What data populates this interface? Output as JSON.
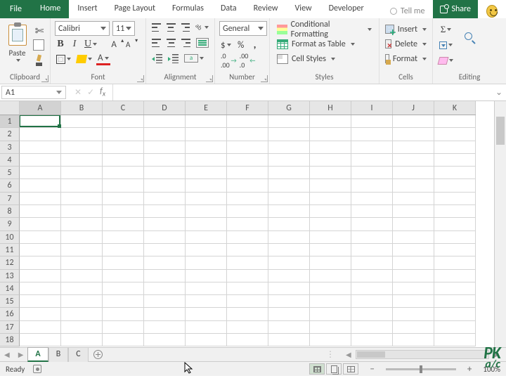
{
  "tabs": {
    "file": "File",
    "home": "Home",
    "insert": "Insert",
    "pagelayout": "Page Layout",
    "formulas": "Formulas",
    "data": "Data",
    "review": "Review",
    "view": "View",
    "developer": "Developer",
    "tellme": "Tell me",
    "share": "Share"
  },
  "ribbon": {
    "clipboard": {
      "label": "Clipboard",
      "paste": "Paste"
    },
    "font": {
      "label": "Font",
      "name": "Calibri",
      "size": "11"
    },
    "alignment": {
      "label": "Alignment"
    },
    "number": {
      "label": "Number",
      "format": "General"
    },
    "styles": {
      "label": "Styles",
      "cf": "Conditional Formatting",
      "table": "Format as Table",
      "cell": "Cell Styles"
    },
    "cells": {
      "label": "Cells",
      "insert": "Insert",
      "delete": "Delete",
      "format": "Format"
    },
    "editing": {
      "label": "Editing"
    }
  },
  "namebox": "A1",
  "formula": "",
  "columns": [
    "A",
    "B",
    "C",
    "D",
    "E",
    "F",
    "G",
    "H",
    "I",
    "J",
    "K"
  ],
  "rows": [
    "1",
    "2",
    "3",
    "4",
    "5",
    "6",
    "7",
    "8",
    "9",
    "10",
    "11",
    "12",
    "13",
    "14",
    "15",
    "16",
    "17",
    "18"
  ],
  "active_cell": "A1",
  "sheets": [
    "A",
    "B",
    "C"
  ],
  "active_sheet": "A",
  "status": {
    "ready": "Ready",
    "zoom": "100%"
  },
  "watermark": {
    "top": "PK",
    "bottom": "a/c"
  }
}
